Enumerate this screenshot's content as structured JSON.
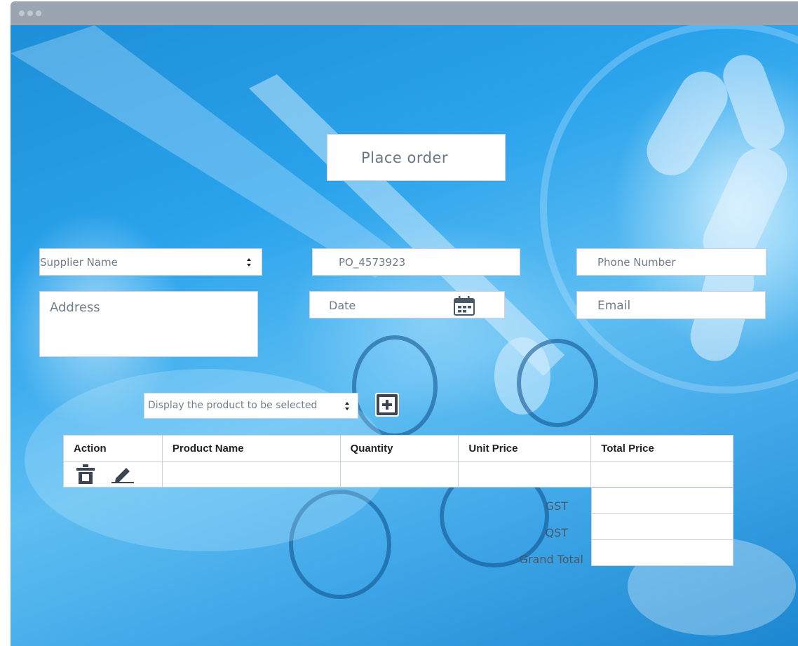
{
  "window": {
    "title_dots": 3
  },
  "header": {
    "title": "Place order"
  },
  "form": {
    "supplier_select": {
      "value": "Supplier Name"
    },
    "po_number": {
      "value": "PO_4573923"
    },
    "phone": {
      "placeholder": "Phone Number"
    },
    "address": {
      "placeholder": "Address"
    },
    "date": {
      "placeholder": "Date"
    },
    "email": {
      "placeholder": "Email"
    },
    "product_select": {
      "value": "Display the product to be selected"
    }
  },
  "table": {
    "headers": [
      "Action",
      "Product Name",
      "Quantity",
      "Unit Price",
      "Total Price"
    ]
  },
  "totals": {
    "gst_label": "GST",
    "qst_label": "QST",
    "grand_total_label": "Grand Total"
  },
  "icons": {
    "calendar": "calendar-icon",
    "add": "plus-square-icon",
    "delete": "trash-icon",
    "edit": "pencil-icon",
    "select_arrow": "updown-chevron-icon"
  },
  "colors": {
    "accent_blue": "#2aa3ec",
    "titlebar": "#9aa5b1",
    "field_border": "#c9d2dc",
    "icon_dark": "#3c4550"
  }
}
